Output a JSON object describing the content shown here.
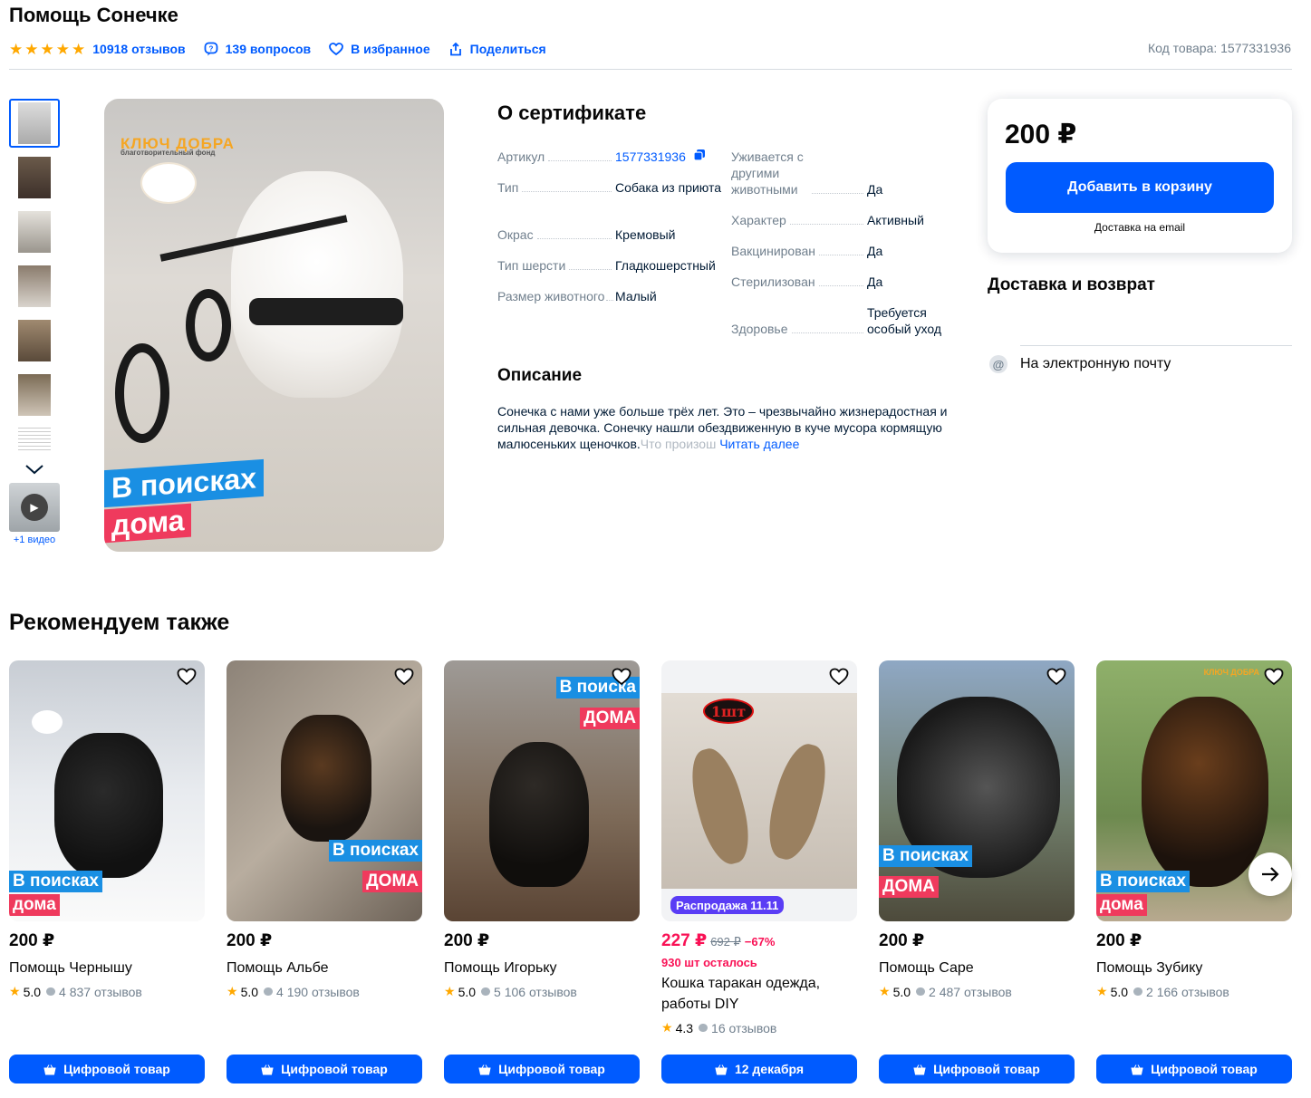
{
  "product": {
    "title": "Помощь Сонечке",
    "reviews": "10918 отзывов",
    "questions": "139 вопросов",
    "favorite": "В избранное",
    "share": "Поделиться",
    "sku": "Код товара: 1577331936",
    "rating_stars": 5,
    "video_label": "+1 видео",
    "image_brand": "КЛЮЧ ДОБРА",
    "image_brand_sub": "благотворительный фонд",
    "image_banner_1": "В поисках",
    "image_banner_2": "дома"
  },
  "about": {
    "title": "О сертификате",
    "left": [
      {
        "key": "Артикул",
        "value": "1577331936"
      },
      {
        "key": "Тип",
        "value": "Собака из приюта"
      },
      {
        "key": "Окрас",
        "value": "Кремовый"
      },
      {
        "key": "Тип шерсти",
        "value": "Гладкошерстный"
      },
      {
        "key": "Размер животного",
        "value": "Малый"
      }
    ],
    "right": [
      {
        "key": "Уживается с другими животными",
        "value": "Да"
      },
      {
        "key": "Характер",
        "value": "Активный"
      },
      {
        "key": "Вакцинирован",
        "value": "Да"
      },
      {
        "key": "Стерилизован",
        "value": "Да"
      },
      {
        "key": "Здоровье",
        "value": "Требуется особый уход"
      }
    ]
  },
  "description": {
    "title": "Описание",
    "text": "Сонечка с нами уже больше трёх лет. Это – чрезвычайно жизнерадостная и сильная девочка. Сонечку нашли обездвиженную в куче мусора кормящую малюсеньких щеночков.",
    "fade": "Что произош",
    "read_more": "Читать далее"
  },
  "buy": {
    "price": "200 ₽",
    "cart_button": "Добавить в корзину",
    "delivery_note": "Доставка на email"
  },
  "delivery": {
    "title": "Доставка и возврат",
    "option": "На электронную почту"
  },
  "recommend": {
    "title": "Рекомендуем также",
    "items": [
      {
        "price": "200 ₽",
        "name": "Помощь Чернышу",
        "rating": "5.0",
        "reviews": "4 837 отзывов",
        "button": "Цифровой товар",
        "b1": "В поисках",
        "b2": "дома"
      },
      {
        "price": "200 ₽",
        "name": "Помощь Альбе",
        "rating": "5.0",
        "reviews": "4 190 отзывов",
        "button": "Цифровой товар",
        "b1": "В поисках",
        "b2": "ДОМА"
      },
      {
        "price": "200 ₽",
        "name": "Помощь Игорьку",
        "rating": "5.0",
        "reviews": "5 106 отзывов",
        "button": "Цифровой товар",
        "b1": "В поиска",
        "b2": "ДОМА"
      },
      {
        "price": "227 ₽",
        "old_price": "692 ₽",
        "discount": "−67%",
        "stock": "930 шт осталось",
        "name": "Кошка таракан одежда, работы DIY",
        "rating": "4.3",
        "reviews": "16 отзывов",
        "button": "12 декабря",
        "sale": "Распродажа 11.11",
        "tag": "1шт"
      },
      {
        "price": "200 ₽",
        "name": "Помощь Саре",
        "rating": "5.0",
        "reviews": "2 487 отзывов",
        "button": "Цифровой товар",
        "b1": "В поисках",
        "b2": "ДОМА"
      },
      {
        "price": "200 ₽",
        "name": "Помощь Зубику",
        "rating": "5.0",
        "reviews": "2 166 отзывов",
        "button": "Цифровой товар",
        "b1": "В поисках",
        "b2": "дома",
        "brand": "КЛЮЧ ДОБРА"
      }
    ]
  },
  "colors": {
    "accent": "#005bff",
    "star": "#ffa800",
    "sale_price": "#f91155",
    "banner_blue": "#1a8fe3",
    "banner_red": "#ef3a5d"
  }
}
